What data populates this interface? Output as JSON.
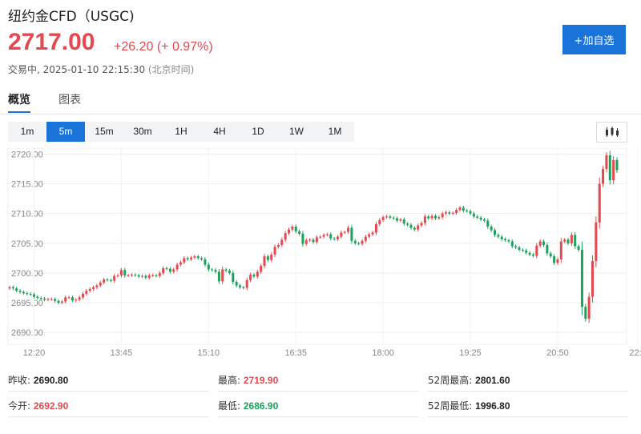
{
  "header": {
    "title": "纽约金CFD（USGC)",
    "price": "2717.00",
    "change": "+26.20",
    "change_pct": "(+ 0.97%)",
    "status": "交易中, ",
    "datetime": "2025-01-10 22:15:30",
    "timezone": "(北京时间)",
    "add_label": "+加自选",
    "up_color": "#e5484d",
    "down_color": "#1aa35c",
    "accent_color": "#1a73d9"
  },
  "tabs": [
    {
      "label": "概览",
      "active": true
    },
    {
      "label": "图表",
      "active": false
    }
  ],
  "intervals": [
    {
      "label": "1m",
      "active": false
    },
    {
      "label": "5m",
      "active": true
    },
    {
      "label": "15m",
      "active": false
    },
    {
      "label": "30m",
      "active": false
    },
    {
      "label": "1H",
      "active": false
    },
    {
      "label": "4H",
      "active": false
    },
    {
      "label": "1D",
      "active": false
    },
    {
      "label": "1W",
      "active": false
    },
    {
      "label": "1M",
      "active": false
    }
  ],
  "chart_type_icon": "candlestick-icon",
  "chart_data": {
    "type": "candlestick",
    "ylim": [
      2688,
      2721
    ],
    "yticks": [
      2690,
      2695,
      2700,
      2705,
      2710,
      2715,
      2720
    ],
    "ytick_labels": [
      "2690.00",
      "2695.00",
      "2700.00",
      "2705.00",
      "2710.00",
      "2715.00",
      "2720.00"
    ],
    "xtick_labels": [
      "12:20",
      "13:45",
      "15:10",
      "16:35",
      "18:00",
      "19:25",
      "20:50",
      "22:1"
    ],
    "xtick_index": [
      7,
      32,
      57,
      82,
      107,
      132,
      157,
      180
    ],
    "grid": true,
    "closes": [
      2697.6,
      2697.4,
      2697.0,
      2696.8,
      2696.6,
      2696.5,
      2696.4,
      2696.0,
      2695.8,
      2695.7,
      2695.5,
      2695.6,
      2695.6,
      2695.3,
      2695.0,
      2695.2,
      2695.9,
      2695.9,
      2695.4,
      2695.5,
      2695.9,
      2696.5,
      2697.0,
      2697.3,
      2697.6,
      2697.9,
      2698.4,
      2698.9,
      2698.8,
      2698.7,
      2699.5,
      2699.6,
      2700.5,
      2699.6,
      2699.6,
      2699.7,
      2699.6,
      2699.4,
      2699.5,
      2699.2,
      2699.6,
      2699.6,
      2699.5,
      2700.0,
      2700.8,
      2700.7,
      2700.2,
      2700.6,
      2701.4,
      2701.8,
      2702.5,
      2702.3,
      2702.6,
      2702.8,
      2702.5,
      2702.3,
      2701.4,
      2700.6,
      2700.5,
      2700.2,
      2698.6,
      2700.6,
      2700.4,
      2700.0,
      2698.5,
      2697.9,
      2697.6,
      2697.5,
      2698.8,
      2699.7,
      2699.4,
      2700.2,
      2701.2,
      2702.8,
      2702.2,
      2703.1,
      2704.4,
      2704.7,
      2705.6,
      2706.7,
      2707.3,
      2707.8,
      2707.0,
      2706.6,
      2704.9,
      2705.5,
      2705.6,
      2705.2,
      2706.0,
      2706.1,
      2706.4,
      2706.5,
      2705.8,
      2705.7,
      2706.1,
      2706.8,
      2706.9,
      2707.6,
      2705.4,
      2705.0,
      2704.9,
      2705.4,
      2706.1,
      2706.5,
      2706.8,
      2708.2,
      2708.9,
      2709.4,
      2709.5,
      2709.3,
      2709.2,
      2708.8,
      2709.0,
      2708.3,
      2708.1,
      2707.6,
      2707.3,
      2708.0,
      2708.4,
      2709.5,
      2709.2,
      2709.6,
      2709.2,
      2709.4,
      2710.0,
      2710.2,
      2710.0,
      2710.1,
      2710.6,
      2711.0,
      2710.5,
      2710.4,
      2710.0,
      2709.5,
      2709.3,
      2709.0,
      2708.8,
      2707.8,
      2707.2,
      2706.4,
      2706.1,
      2705.7,
      2705.5,
      2705.3,
      2704.5,
      2704.3,
      2703.9,
      2703.8,
      2703.4,
      2703.1,
      2702.9,
      2704.6,
      2705.3,
      2704.7,
      2703.3,
      2702.8,
      2701.7,
      2702.3,
      2705.3,
      2705.6,
      2705.0,
      2706.4,
      2704.5,
      2703.9,
      2694.3,
      2692.3,
      2696.0,
      2702.0,
      2708.5,
      2715.0,
      2717.5,
      2719.8,
      2715.6,
      2719.0,
      2717.3
    ]
  },
  "stats": [
    [
      {
        "label": "昨收:",
        "value": "2690.80",
        "tone": "nt"
      },
      {
        "label": "最高:",
        "value": "2719.90",
        "tone": "up"
      },
      {
        "label": "52周最高:",
        "value": "2801.60",
        "tone": "nt"
      }
    ],
    [
      {
        "label": "今开:",
        "value": "2692.90",
        "tone": "up"
      },
      {
        "label": "最低:",
        "value": "2686.90",
        "tone": "dn"
      },
      {
        "label": "52周最低:",
        "value": "1996.80",
        "tone": "nt"
      }
    ]
  ]
}
